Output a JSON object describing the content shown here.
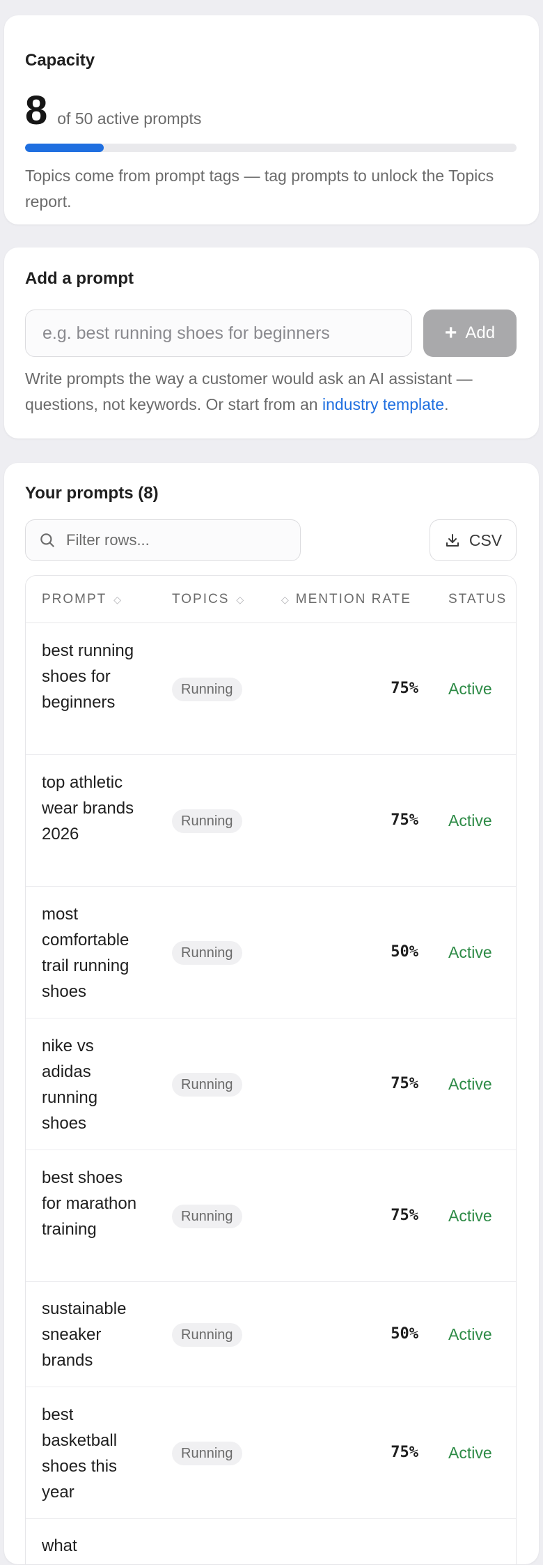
{
  "capacity": {
    "title": "Capacity",
    "active_count": "8",
    "of_text": "of 50 active prompts",
    "fill_fraction": 0.16,
    "note": "Topics come from prompt tags — tag prompts to unlock the Topics report."
  },
  "add_prompt": {
    "title": "Add a prompt",
    "placeholder": "e.g. best running shoes for beginners",
    "button_label": "Add",
    "help_text": "Write prompts the way a customer would ask an AI assistant — questions, not keywords. Or start from an ",
    "help_link": "industry template",
    "help_end": "."
  },
  "prompts": {
    "title": "Your prompts (8)",
    "filter_placeholder": "Filter rows...",
    "csv_label": "CSV",
    "columns": {
      "prompt": "PROMPT",
      "topics": "TOPICS",
      "mention_rate": "MENTION RATE",
      "status": "STATUS"
    },
    "rows": [
      {
        "prompt": "best running shoes for beginners",
        "topic": "Running",
        "rate": "75%",
        "status": "Active"
      },
      {
        "prompt": "top athletic wear brands 2026",
        "topic": "Running",
        "rate": "75%",
        "status": "Active"
      },
      {
        "prompt": "most comfortable trail running shoes",
        "topic": "Running",
        "rate": "50%",
        "status": "Active"
      },
      {
        "prompt": "nike vs adidas running shoes",
        "topic": "Running",
        "rate": "75%",
        "status": "Active"
      },
      {
        "prompt": "best shoes for marathon training",
        "topic": "Running",
        "rate": "75%",
        "status": "Active"
      },
      {
        "prompt": "sustainable sneaker brands",
        "topic": "Running",
        "rate": "50%",
        "status": "Active"
      },
      {
        "prompt": "best basketball shoes this year",
        "topic": "Running",
        "rate": "75%",
        "status": "Active"
      },
      {
        "prompt": "what",
        "topic": "",
        "rate": "",
        "status": ""
      }
    ]
  },
  "icons": {
    "search": "search-icon",
    "download": "download-icon",
    "sort": "sort-icon",
    "plus": "plus-icon"
  },
  "colors": {
    "accent": "#1f6fe0",
    "active_status": "#2c8a45",
    "disabled_button": "#a9a9ab"
  }
}
